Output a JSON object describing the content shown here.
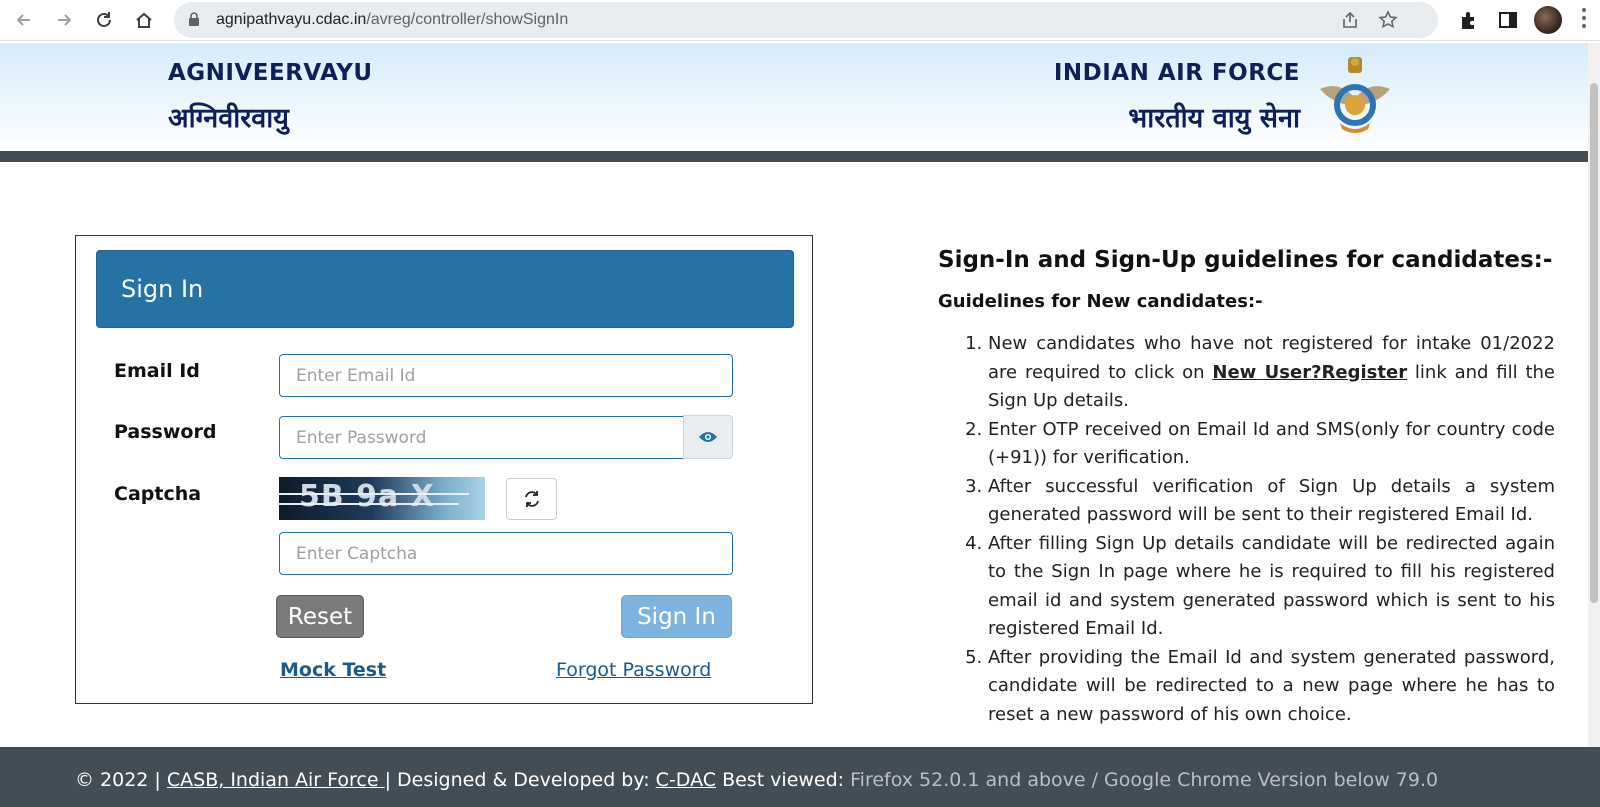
{
  "browser": {
    "url_host": "agnipathvayu.cdac.in",
    "url_path": "/avreg/controller/showSignIn"
  },
  "header": {
    "brand_en": "AGNIVEERVAYU",
    "brand_hi": "अग्निवीरवायु",
    "org_en": "INDIAN AIR FORCE",
    "org_hi": "भारतीय वायु सेना"
  },
  "signin": {
    "title": "Sign In",
    "email_label": "Email Id",
    "email_placeholder": "Enter Email Id",
    "password_label": "Password",
    "password_placeholder": "Enter Password",
    "captcha_label": "Captcha",
    "captcha_text": "5B 9a X",
    "captcha_placeholder": "Enter Captcha",
    "reset_label": "Reset",
    "submit_label": "Sign In",
    "mock_test_label": "Mock Test",
    "forgot_password_label": "Forgot Password"
  },
  "guidelines": {
    "title": "Sign-In and Sign-Up guidelines for candidates:-",
    "subtitle": "Guidelines for New candidates:-",
    "items": [
      {
        "before": "New candidates who have not registered for intake 01/2022 are required to click on ",
        "link": "New User?Register",
        "after": " link and fill the Sign Up details."
      },
      {
        "text": "Enter OTP received on Email Id and SMS(only for country code (+91)) for verification."
      },
      {
        "text": "After successful verification of Sign Up details a system generated password will be sent to their registered Email Id."
      },
      {
        "text": "After filling Sign Up details candidate will be redirected again to the Sign In page where he is required to fill his registered email id and system generated password which is sent to his registered Email Id."
      },
      {
        "text": "After providing the Email Id and system generated password, candidate will be redirected to a new page where he has to reset a new password of his own choice."
      }
    ]
  },
  "footer": {
    "copyright": "© 2022 | ",
    "casb_link": "CASB, Indian Air Force ",
    "designed_by": "| Designed & Developed by: ",
    "cdac_link": "C-DAC",
    "best_viewed": " Best viewed: ",
    "browsers": "Firefox 52.0.1 and above / Google Chrome Version below 79.0"
  },
  "colors": {
    "header_bar": "#2573a5",
    "footer_bg": "#434d55",
    "brand_text": "#0f1f5c"
  }
}
